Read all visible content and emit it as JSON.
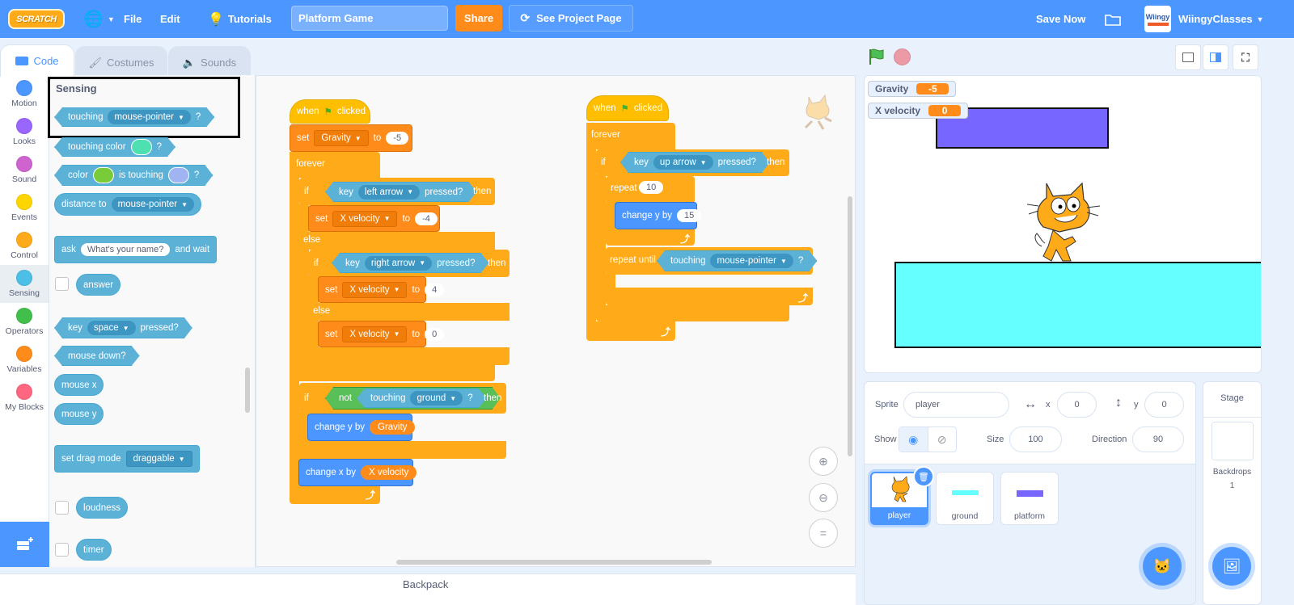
{
  "menubar": {
    "logo": "SCRATCH",
    "file": "File",
    "edit": "Edit",
    "tutorials": "Tutorials",
    "project_title": "Platform Game",
    "share": "Share",
    "see_project_page": "See Project Page",
    "save_now": "Save Now",
    "username": "WiingyClasses",
    "avatar_text": "Wiingy"
  },
  "tabs": [
    {
      "label": "Code",
      "active": true
    },
    {
      "label": "Costumes",
      "active": false
    },
    {
      "label": "Sounds",
      "active": false
    }
  ],
  "categories": [
    {
      "label": "Motion",
      "color": "#4c97ff"
    },
    {
      "label": "Looks",
      "color": "#9966ff"
    },
    {
      "label": "Sound",
      "color": "#cf63cf"
    },
    {
      "label": "Events",
      "color": "#ffd500"
    },
    {
      "label": "Control",
      "color": "#ffab19"
    },
    {
      "label": "Sensing",
      "color": "#4cbfe6",
      "active": true
    },
    {
      "label": "Operators",
      "color": "#40bf4a"
    },
    {
      "label": "Variables",
      "color": "#ff8c1a"
    },
    {
      "label": "My Blocks",
      "color": "#ff6680"
    }
  ],
  "palette": {
    "title": "Sensing",
    "touching": "touching",
    "mouse_pointer": "mouse-pointer",
    "question": "?",
    "touching_color": "touching color",
    "color": "color",
    "is_touching": "is touching",
    "distance_to": "distance to",
    "ask": "ask",
    "ask_default": "What's your name?",
    "and_wait": "and wait",
    "answer": "answer",
    "key": "key",
    "space": "space",
    "pressed": "pressed?",
    "mouse_down": "mouse down?",
    "mouse_x": "mouse x",
    "mouse_y": "mouse y",
    "set_drag_mode": "set drag mode",
    "draggable": "draggable",
    "loudness": "loudness",
    "timer": "timer"
  },
  "script1": {
    "when": "when",
    "clicked": "clicked",
    "set": "set",
    "gravity": "Gravity",
    "to": "to",
    "gravity_val": "-5",
    "forever": "forever",
    "if": "if",
    "then": "then",
    "else": "else",
    "key": "key",
    "left_arrow": "left arrow",
    "right_arrow": "right arrow",
    "pressed": "pressed?",
    "x_velocity": "X velocity",
    "xv_left": "-4",
    "xv_right": "4",
    "xv_zero": "0",
    "not": "not",
    "touching": "touching",
    "ground": "ground",
    "question": "?",
    "change_y_by": "change y by",
    "change_x_by": "change x by"
  },
  "script2": {
    "when": "when",
    "clicked": "clicked",
    "forever": "forever",
    "if": "if",
    "then": "then",
    "key": "key",
    "up_arrow": "up arrow",
    "pressed": "pressed?",
    "repeat": "repeat",
    "repeat_count": "10",
    "change_y_by": "change y by",
    "change_y_val": "15",
    "repeat_until": "repeat until",
    "touching": "touching",
    "mouse_pointer": "mouse-pointer",
    "question": "?"
  },
  "backpack": "Backpack",
  "stage": {
    "monitors": [
      {
        "label": "Gravity",
        "value": "-5"
      },
      {
        "label": "X velocity",
        "value": "0"
      }
    ],
    "colors": {
      "platform": "#7766ff",
      "ground": "#66ffff"
    }
  },
  "sprite_info": {
    "sprite_label": "Sprite",
    "sprite_name": "player",
    "x_label": "x",
    "x": "0",
    "y_label": "y",
    "y": "0",
    "show_label": "Show",
    "size_label": "Size",
    "size": "100",
    "direction_label": "Direction",
    "direction": "90"
  },
  "sprites": [
    {
      "name": "player",
      "selected": true
    },
    {
      "name": "ground",
      "selected": false
    },
    {
      "name": "platform",
      "selected": false
    }
  ],
  "stage_pane": {
    "title": "Stage",
    "backdrops_label": "Backdrops",
    "backdrops_count": "1"
  }
}
